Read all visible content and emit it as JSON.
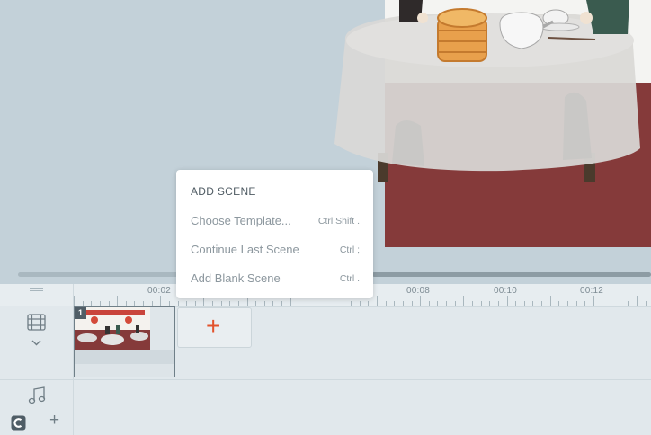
{
  "timeline": {
    "ruler_labels": [
      "00:02",
      "00:08",
      "00:10",
      "00:12"
    ],
    "scene_number": "1",
    "add_scene_symbol": "+",
    "add_track_symbol": "+",
    "icons": [
      "film-strip-icon",
      "chevron-down-icon",
      "music-note-icon",
      "c-logo-icon",
      "plus-icon",
      "drag-handle-icon"
    ]
  },
  "menu": {
    "title": "ADD SCENE",
    "items": [
      {
        "label": "Choose Template...",
        "shortcut": "Ctrl Shift ."
      },
      {
        "label": "Continue Last Scene",
        "shortcut": "Ctrl ;"
      },
      {
        "label": "Add Blank Scene",
        "shortcut": "Ctrl ."
      }
    ]
  },
  "colors": {
    "stage_bg": "#c3d1d9",
    "scene_floor": "#853a3a",
    "accent": "#e2522c",
    "timeline_bg": "#e1e8ec"
  }
}
